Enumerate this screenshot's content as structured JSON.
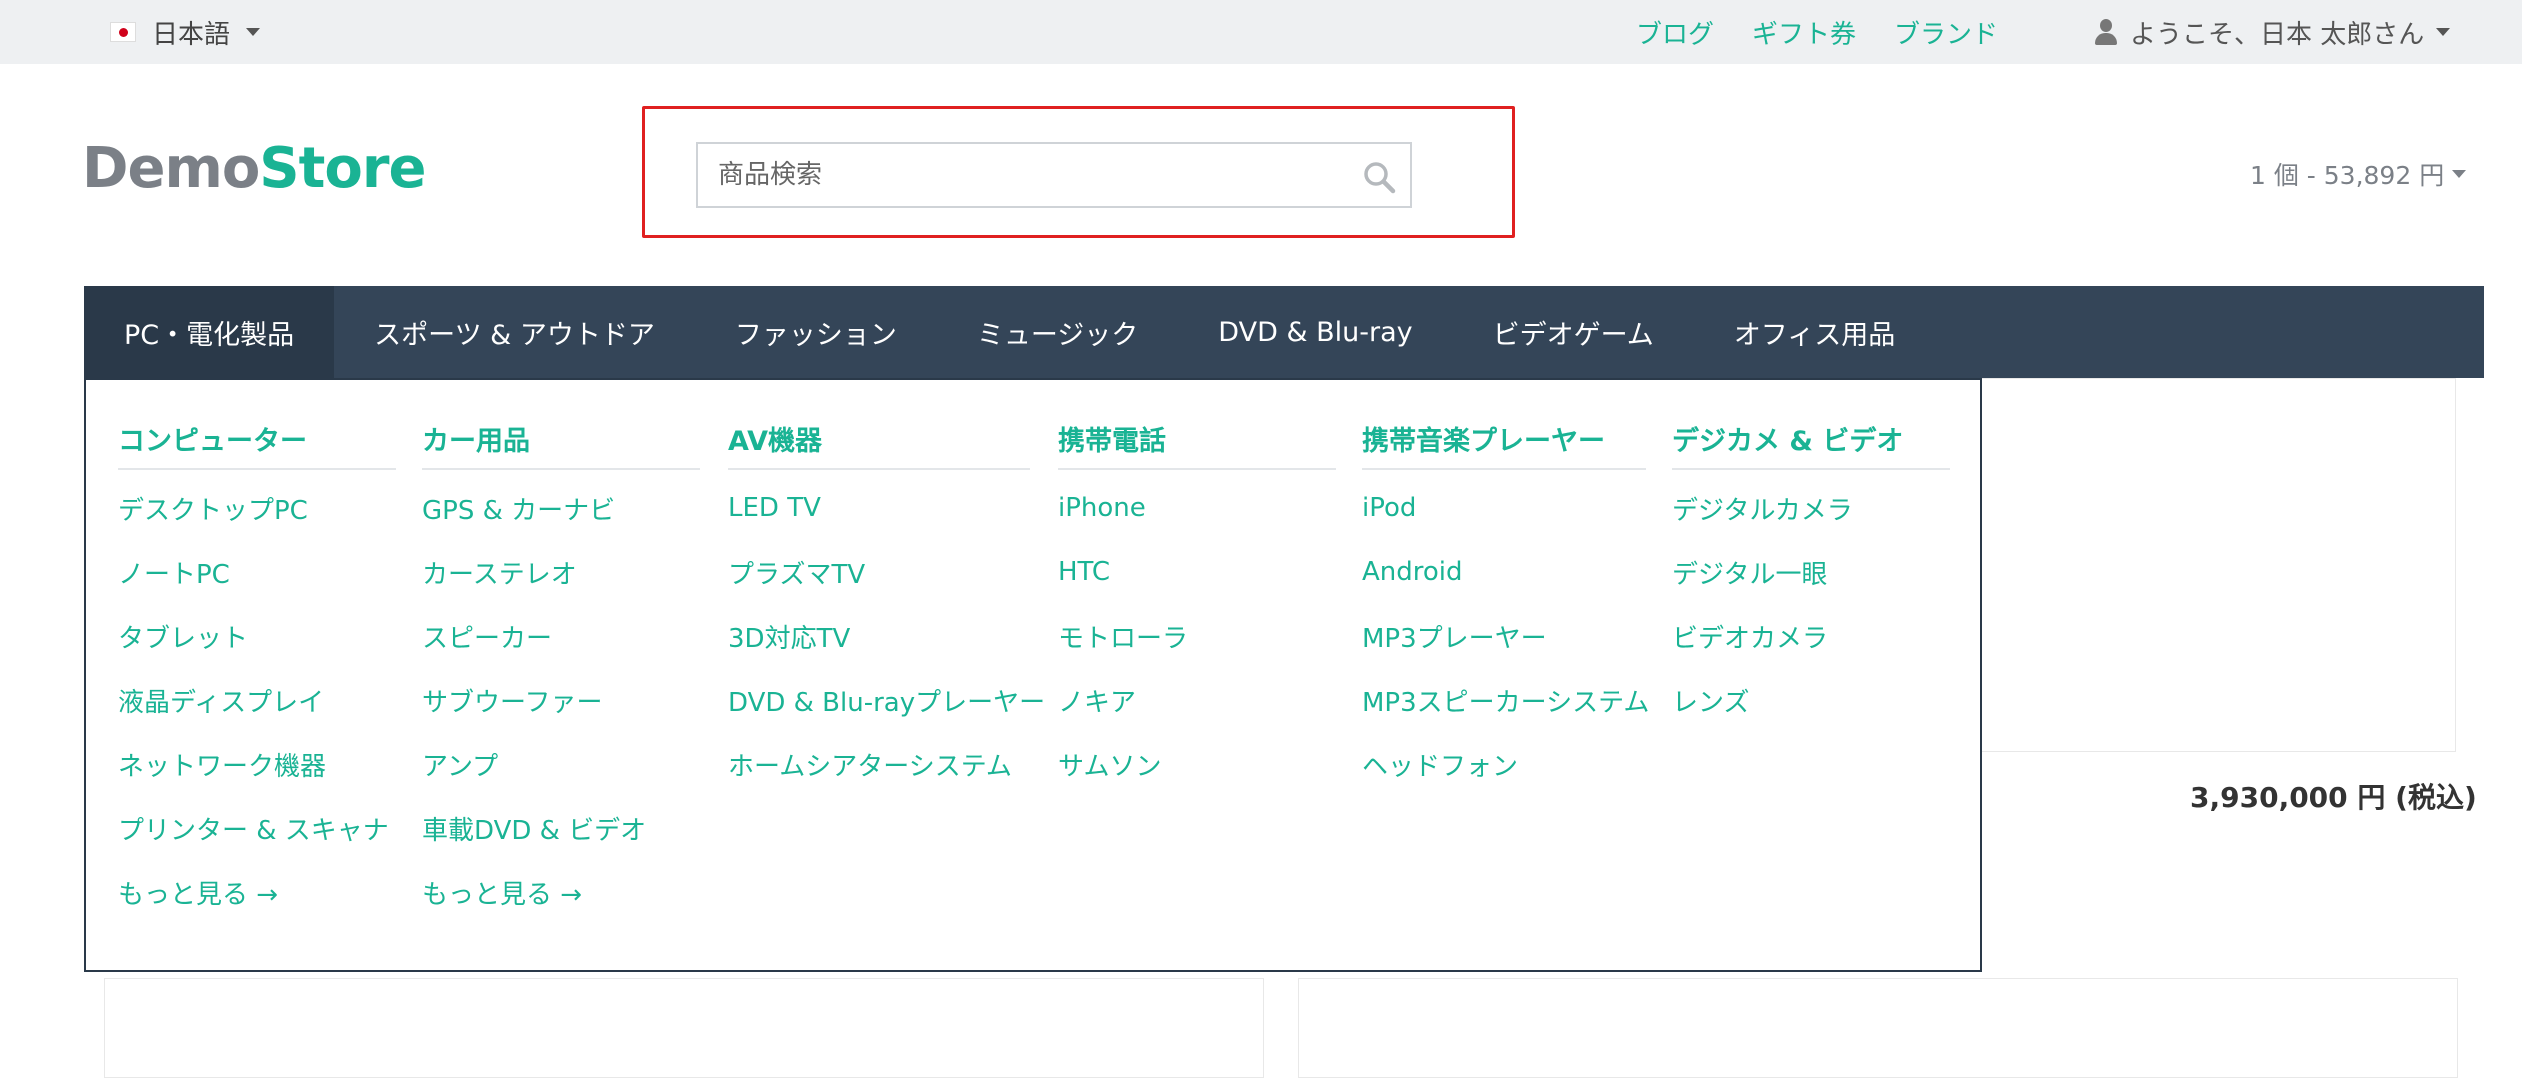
{
  "topbar": {
    "language": "日本語",
    "links": [
      "ブログ",
      "ギフト券",
      "ブランド"
    ],
    "user_greeting": "ようこそ、日本 太郎さん"
  },
  "logo": {
    "part1": "Demo",
    "part2": "Store"
  },
  "search": {
    "placeholder": "商品検索"
  },
  "cart": {
    "summary": "1 個 - 53,892 円"
  },
  "nav": {
    "items": [
      "PC・電化製品",
      "スポーツ & アウトドア",
      "ファッション",
      "ミュージック",
      "DVD & Blu-ray",
      "ビデオゲーム",
      "オフィス用品"
    ]
  },
  "mega_menu": {
    "columns": [
      {
        "title": "コンピューター",
        "items": [
          "デスクトップPC",
          "ノートPC",
          "タブレット",
          "液晶ディスプレイ",
          "ネットワーク機器",
          "プリンター & スキャナ",
          "もっと見る →"
        ]
      },
      {
        "title": "カー用品",
        "items": [
          "GPS & カーナビ",
          "カーステレオ",
          "スピーカー",
          "サブウーファー",
          "アンプ",
          "車載DVD & ビデオ",
          "もっと見る →"
        ]
      },
      {
        "title": "AV機器",
        "items": [
          "LED TV",
          "プラズマTV",
          "3D対応TV",
          "DVD & Blu-rayプレーヤー",
          "ホームシアターシステム"
        ]
      },
      {
        "title": "携帯電話",
        "items": [
          "iPhone",
          "HTC",
          "モトローラ",
          "ノキア",
          "サムソン"
        ]
      },
      {
        "title": "携帯音楽プレーヤー",
        "items": [
          "iPod",
          "Android",
          "MP3プレーヤー",
          "MP3スピーカーシステム",
          "ヘッドフォン"
        ]
      },
      {
        "title": "デジカメ & ビデオ",
        "items": [
          "デジタルカメラ",
          "デジタル一眼",
          "ビデオカメラ",
          "レンズ"
        ]
      }
    ]
  },
  "product": {
    "price": "3,930,000 円 (税込)"
  },
  "colors": {
    "accent": "#1ab394",
    "nav_bg": "#344558",
    "nav_active": "#2a3949",
    "highlight": "#e02020",
    "topbar_bg": "#eef0f2"
  }
}
